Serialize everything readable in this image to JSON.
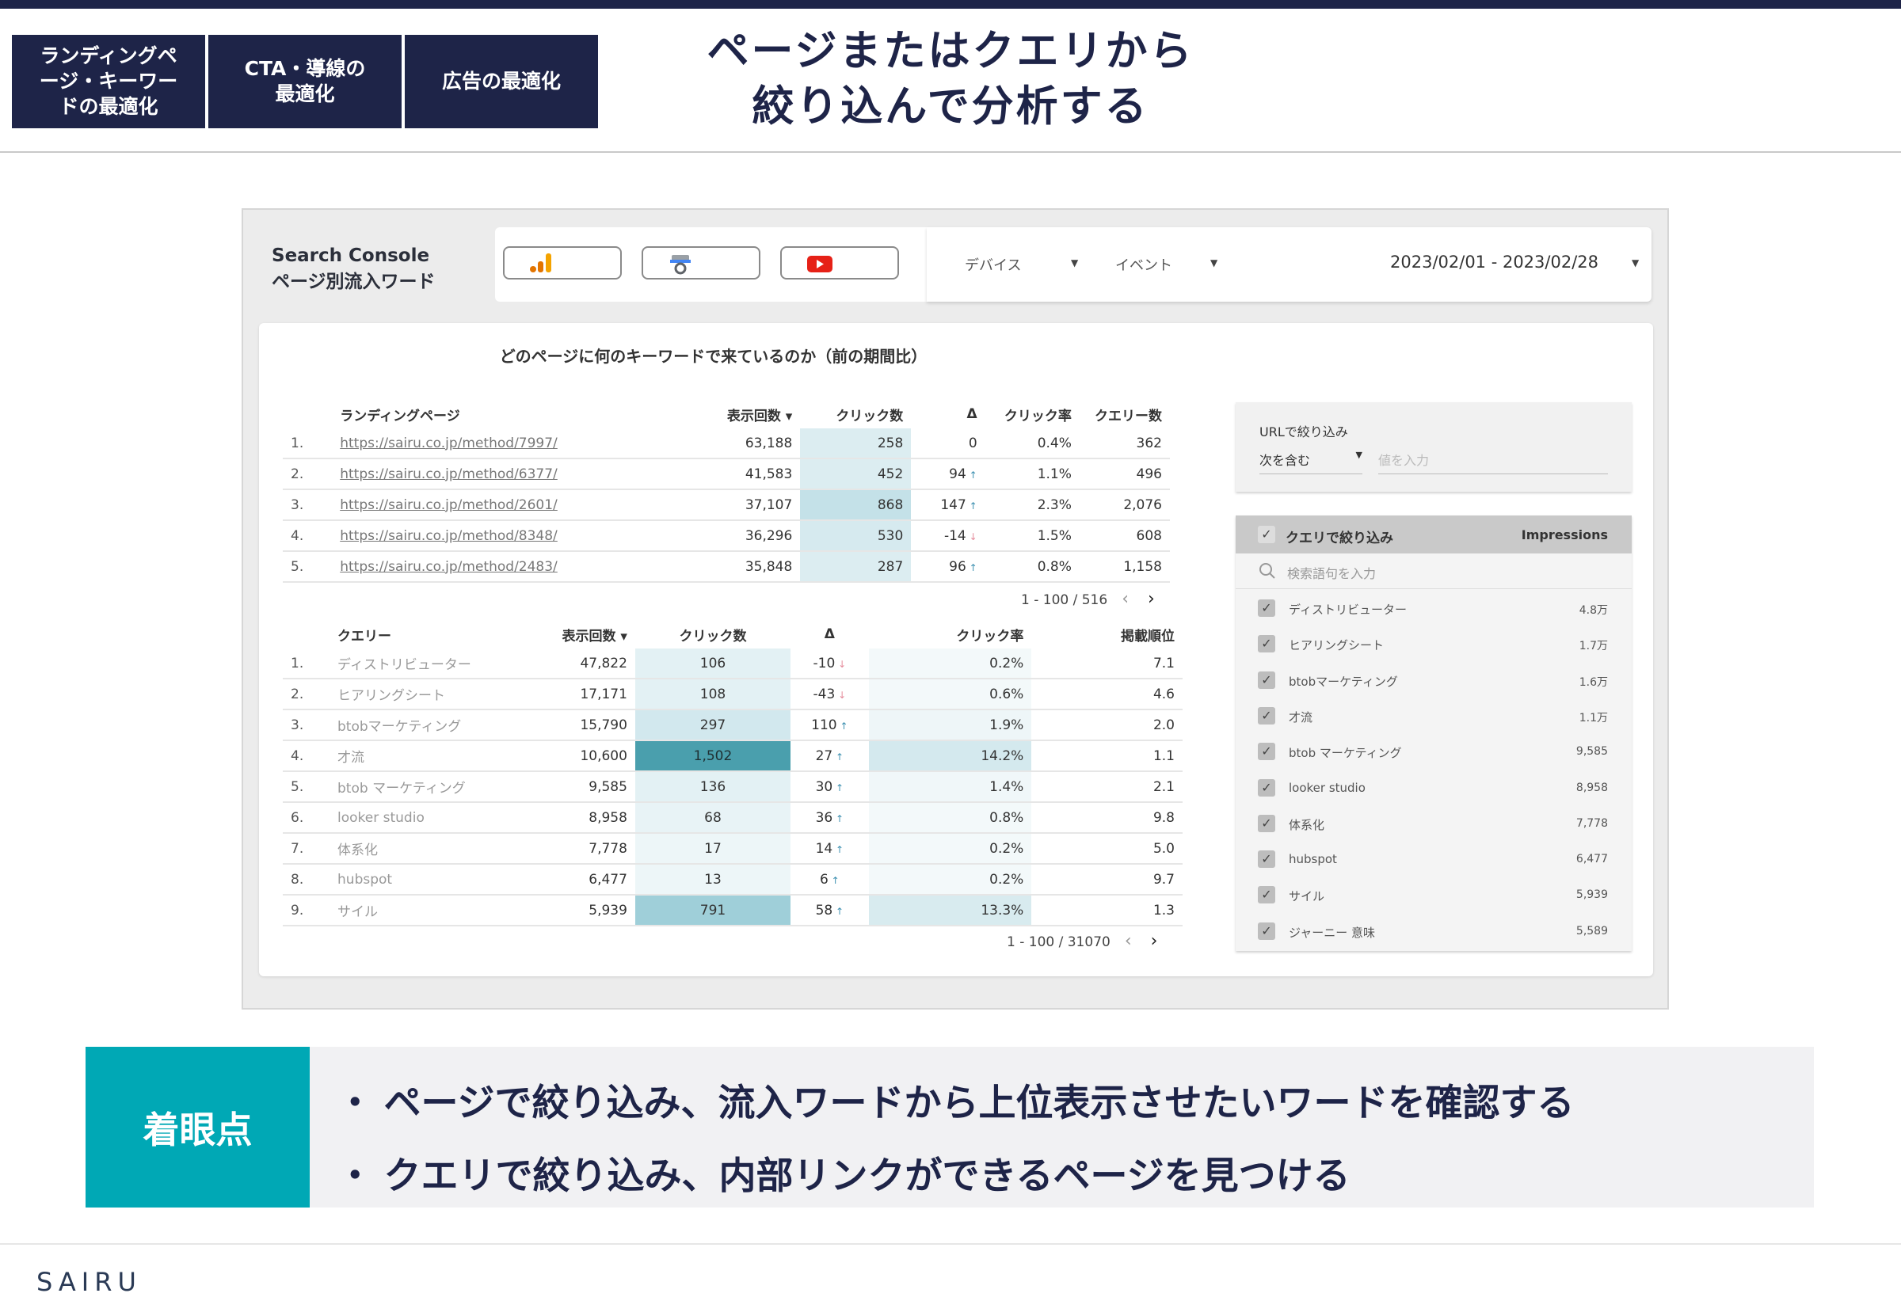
{
  "tabs": [
    "ランディングペ\nージ・キーワー\nドの最適化",
    "CTA・導線の\n最適化",
    "広告の最適化"
  ],
  "page_title": "ページまたはクエリから\n絞り込んで分析する",
  "report": {
    "title": "Search Console\nページ別流入ワード",
    "filters": {
      "device": "デバイス",
      "event": "イベント",
      "date_range": "2023/02/01 - 2023/02/28"
    },
    "panel_title": "どのページに何のキーワードで来ているのか（前の期間比）",
    "pages_table": {
      "headers": [
        "ランディングページ",
        "表示回数 ▾",
        "クリック数",
        "Δ",
        "クリック率",
        "クエリー数"
      ],
      "rows": [
        {
          "n": "1.",
          "url": "https://sairu.co.jp/method/7997/",
          "imp": "63,188",
          "clicks": "258",
          "delta": "0",
          "dir": "",
          "ctr": "0.4%",
          "queries": "362",
          "shade": "#dcedf1"
        },
        {
          "n": "2.",
          "url": "https://sairu.co.jp/method/6377/",
          "imp": "41,583",
          "clicks": "452",
          "delta": "94",
          "dir": "up",
          "ctr": "1.1%",
          "queries": "496",
          "shade": "#dcedf1"
        },
        {
          "n": "3.",
          "url": "https://sairu.co.jp/method/2601/",
          "imp": "37,107",
          "clicks": "868",
          "delta": "147",
          "dir": "up",
          "ctr": "2.3%",
          "queries": "2,076",
          "shade": "#c4e1e8"
        },
        {
          "n": "4.",
          "url": "https://sairu.co.jp/method/8348/",
          "imp": "36,296",
          "clicks": "530",
          "delta": "-14",
          "dir": "dn",
          "ctr": "1.5%",
          "queries": "608",
          "shade": "#d6eaef"
        },
        {
          "n": "5.",
          "url": "https://sairu.co.jp/method/2483/",
          "imp": "35,848",
          "clicks": "287",
          "delta": "96",
          "dir": "up",
          "ctr": "0.8%",
          "queries": "1,158",
          "shade": "#dcedf1"
        }
      ],
      "pager": "1 - 100 / 516"
    },
    "query_table": {
      "headers": [
        "クエリー",
        "表示回数 ▾",
        "クリック数",
        "Δ",
        "クリック率",
        "掲載順位"
      ],
      "rows": [
        {
          "n": "1.",
          "q": "ディストリビューター",
          "imp": "47,822",
          "clicks": "106",
          "delta": "-10",
          "dir": "dn",
          "ctr": "0.2%",
          "pos": "7.1",
          "cshade": "#e3f1f4",
          "rshade": "#f3f9fa"
        },
        {
          "n": "2.",
          "q": "ヒアリングシート",
          "imp": "17,171",
          "clicks": "108",
          "delta": "-43",
          "dir": "dn",
          "ctr": "0.6%",
          "pos": "4.6",
          "cshade": "#e3f1f4",
          "rshade": "#f3f9fa"
        },
        {
          "n": "3.",
          "q": "btobマーケティング",
          "imp": "15,790",
          "clicks": "297",
          "delta": "110",
          "dir": "up",
          "ctr": "1.9%",
          "pos": "2.0",
          "cshade": "#d2e8ee",
          "rshade": "#eef6f8"
        },
        {
          "n": "4.",
          "q": "才流",
          "imp": "10,600",
          "clicks": "1,502",
          "delta": "27",
          "dir": "up",
          "ctr": "14.2%",
          "pos": "1.1",
          "cshade": "#4a9fad",
          "rshade": "#d4e9ee"
        },
        {
          "n": "5.",
          "q": "btob マーケティング",
          "imp": "9,585",
          "clicks": "136",
          "delta": "30",
          "dir": "up",
          "ctr": "1.4%",
          "pos": "2.1",
          "cshade": "#e3f1f4",
          "rshade": "#f0f7f9"
        },
        {
          "n": "6.",
          "q": "looker studio",
          "imp": "8,958",
          "clicks": "68",
          "delta": "36",
          "dir": "up",
          "ctr": "0.8%",
          "pos": "9.8",
          "cshade": "#e8f3f6",
          "rshade": "#f3f9fa"
        },
        {
          "n": "7.",
          "q": "体系化",
          "imp": "7,778",
          "clicks": "17",
          "delta": "14",
          "dir": "up",
          "ctr": "0.2%",
          "pos": "5.0",
          "cshade": "#edf6f8",
          "rshade": "#f3f9fa"
        },
        {
          "n": "8.",
          "q": "hubspot",
          "imp": "6,477",
          "clicks": "13",
          "delta": "6",
          "dir": "up",
          "ctr": "0.2%",
          "pos": "9.7",
          "cshade": "#edf6f8",
          "rshade": "#f3f9fa"
        },
        {
          "n": "9.",
          "q": "サイル",
          "imp": "5,939",
          "clicks": "791",
          "delta": "58",
          "dir": "up",
          "ctr": "13.3%",
          "pos": "1.3",
          "cshade": "#9fcfd9",
          "rshade": "#d8ebef"
        }
      ],
      "pager": "1 - 100 / 31070"
    },
    "url_filter": {
      "label": "URLで絞り込み",
      "operator": "次を含む",
      "placeholder": "値を入力"
    },
    "query_filter": {
      "title": "クエリで絞り込み",
      "metric": "Impressions",
      "search_placeholder": "検索語句を入力",
      "items": [
        {
          "name": "ディストリビューター",
          "value": "4.8万"
        },
        {
          "name": "ヒアリングシート",
          "value": "1.7万"
        },
        {
          "name": "btobマーケティング",
          "value": "1.6万"
        },
        {
          "name": "才流",
          "value": "1.1万"
        },
        {
          "name": "btob マーケティング",
          "value": "9,585"
        },
        {
          "name": "looker studio",
          "value": "8,958"
        },
        {
          "name": "体系化",
          "value": "7,778"
        },
        {
          "name": "hubspot",
          "value": "6,477"
        },
        {
          "name": "サイル",
          "value": "5,939"
        },
        {
          "name": "ジャーニー 意味",
          "value": "5,589"
        }
      ]
    }
  },
  "callout": {
    "label": "着眼点",
    "points": [
      "ページで絞り込み、流入ワードから上位表示させたいワードを確認する",
      "クエリで絞り込み、内部リンクができるページを見つける"
    ]
  },
  "footer": {
    "logo": "SAIRU"
  },
  "colors": {
    "navy": "#1e2448",
    "accent": "#00a8b5"
  }
}
